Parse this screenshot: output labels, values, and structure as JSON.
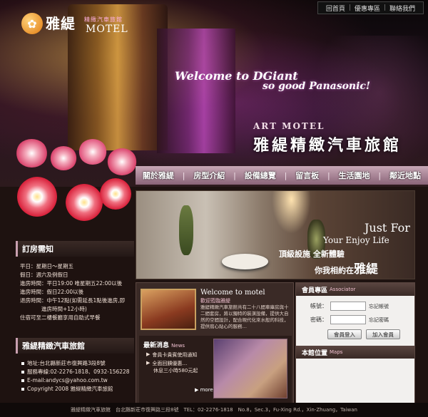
{
  "header": {
    "logo_name": "雅緹",
    "logo_sub": "精緻汽車旅館",
    "logo_motel": "MOTEL",
    "welcome_line1": "Welcome to DGiant",
    "welcome_line2": "so good Panasonic!",
    "art_motel": "ART MOTEL",
    "hotel_name": "雅緹精緻汽車旅館"
  },
  "top_nav": [
    "回首頁",
    "優惠專區",
    "聯絡我們"
  ],
  "main_nav": [
    "關於雅緹",
    "房型介紹",
    "設備總覽",
    "留言板",
    "生活園地",
    "鄰近地點"
  ],
  "banner": {
    "just_for": "Just For",
    "enjoy": "Your Enjoy Life",
    "line1": "頂級設施  全新體驗",
    "line2_prefix": "你我相約在",
    "line2_big": "雅緹"
  },
  "booking": {
    "title": "訂房需知",
    "lines": [
      "平日：星期日～星期五",
      "假日：週六及例假日",
      "進房時間：平日19:00  唯星期五22:00以後",
      "進房時間：假日22:00以後",
      "退房時間：中午12點(如需延長1點後進房,即",
      "　　　　進房時間+12小時)",
      "住宿可至二樓餐廳享用自助式早餐"
    ]
  },
  "contact": {
    "title": "雅緹精緻汽車旅館",
    "lines": [
      "地址:台北縣新莊市復興路3段8號",
      "服務專線:02-2276-1818、0932-156228",
      "E-mail:andycs@yahoo.com.tw",
      "Copyright 2008 雅緹精緻汽車旅館"
    ]
  },
  "welcome": {
    "title": "Welcome to motel",
    "subtitle": "歡迎蒞臨雅緹",
    "body": "雅緹精緻汽車旅館共有二十八間車庫房與十二間套房，將以獨特的裝潢設備，提供大自然的空間設計，配合現代化來水般的科技，提供窩心貼心的服務…"
  },
  "news": {
    "title": "最新消息",
    "title_en": "News",
    "items": [
      "會員卡貴賓使用通知",
      "全面回饋優惠…",
      "休息三小時580元起"
    ],
    "more": "more"
  },
  "member": {
    "title": "會員專區",
    "title_en": "Associator",
    "account_label": "帳號：",
    "password_label": "密碼：",
    "forgot_account": "忘記帳號",
    "forgot_password": "忘記密碼",
    "login": "會員登入",
    "join": "加入會員"
  },
  "maps": {
    "title": "本館位置",
    "title_en": "Maps"
  },
  "footer": "雅緹精緻汽車旅館　台北縣新莊市復興路三段8號　TEL：02-2276-1818　No.8，Sec.3，Fu-Xing Rd.，Xin-Zhuang，Taiwan"
}
